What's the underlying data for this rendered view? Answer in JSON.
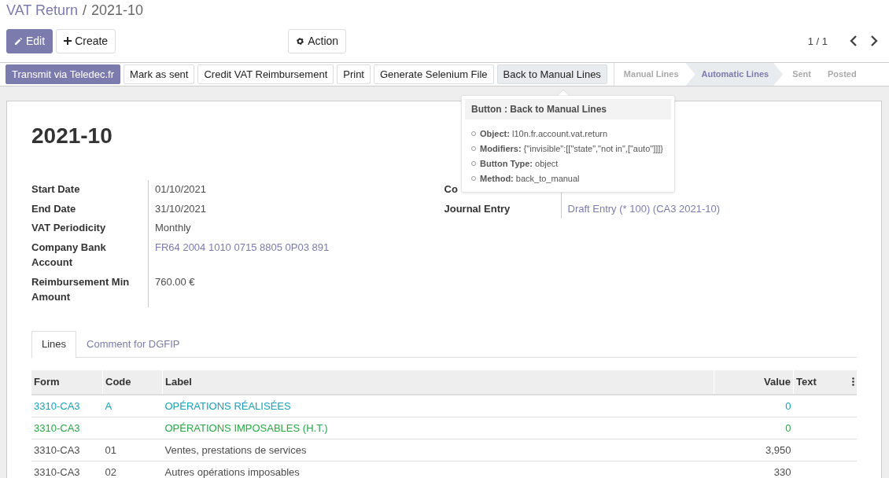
{
  "breadcrumb": {
    "separator": "/",
    "items": [
      {
        "label": "VAT Return",
        "link": true
      },
      {
        "label": "2021-10",
        "link": false
      }
    ]
  },
  "toolbar": {
    "edit": "Edit",
    "create": "Create",
    "action": "Action",
    "pager": "1 / 1"
  },
  "header_buttons": [
    {
      "label": "Transmit via Teledec.fr",
      "primary": true
    },
    {
      "label": "Mark as sent",
      "primary": false
    },
    {
      "label": "Credit VAT Reimbursement",
      "primary": false
    },
    {
      "label": "Print",
      "primary": false
    },
    {
      "label": "Generate Selenium File",
      "primary": false,
      "hovered": false
    },
    {
      "label": "Back to Manual Lines",
      "primary": false,
      "hovered": true
    }
  ],
  "statuses": [
    {
      "label": "Manual Lines",
      "selected": false
    },
    {
      "label": "Automatic Lines",
      "selected": true
    },
    {
      "label": "Sent",
      "selected": false
    },
    {
      "label": "Posted",
      "selected": false
    }
  ],
  "title": "2021-10",
  "left_fields": [
    {
      "label": "Start Date",
      "value": "01/10/2021",
      "link": false
    },
    {
      "label": "End Date",
      "value": "31/10/2021",
      "link": false
    },
    {
      "label": "VAT Periodicity",
      "value": "Monthly",
      "link": false
    },
    {
      "label": "Company Bank Account",
      "value": "FR64 2004 1010 0715 8805 0P03 891",
      "link": true
    },
    {
      "label": "Reimbursement Min Amount",
      "value": "760.00 €",
      "link": false
    }
  ],
  "right_fields": [
    {
      "label": "Co"
    },
    {
      "label": "Journal Entry",
      "value": "Draft Entry (* 100) (CA3 2021-10)",
      "link": true
    }
  ],
  "tooltip": {
    "title": "Button : Back to Manual Lines",
    "items": [
      {
        "key": "Object:",
        "value": "l10n.fr.account.vat.return"
      },
      {
        "key": "Modifiers:",
        "value": "{\"invisible\":[[\"state\",\"not in\",[\"auto\"]]]}"
      },
      {
        "key": "Button Type:",
        "value": "object"
      },
      {
        "key": "Method:",
        "value": "back_to_manual"
      }
    ]
  },
  "tabs": [
    {
      "label": "Lines",
      "selected": true
    },
    {
      "label": "Comment for DGFIP",
      "selected": false
    }
  ],
  "table": {
    "columns": [
      "Form",
      "Code",
      "Label",
      "Value",
      "Text"
    ],
    "rows": [
      {
        "form": "3310-CA3",
        "code": "A",
        "label": "OPÉRATIONS RÉALISÉES",
        "value": "0",
        "color": "#17a2b8"
      },
      {
        "form": "3310-CA3",
        "label": "OPÉRATIONS IMPOSABLES (H.T.)",
        "value": "0",
        "color": "#28a745"
      },
      {
        "form": "3310-CA3",
        "code": "01",
        "label": "Ventes, prestations de services",
        "value": "3,950",
        "color": "#4c4c4c"
      },
      {
        "form": "3310-CA3",
        "code": "02",
        "label": "Autres opérations imposables",
        "value": "330",
        "color": "#4c4c4c"
      }
    ]
  }
}
